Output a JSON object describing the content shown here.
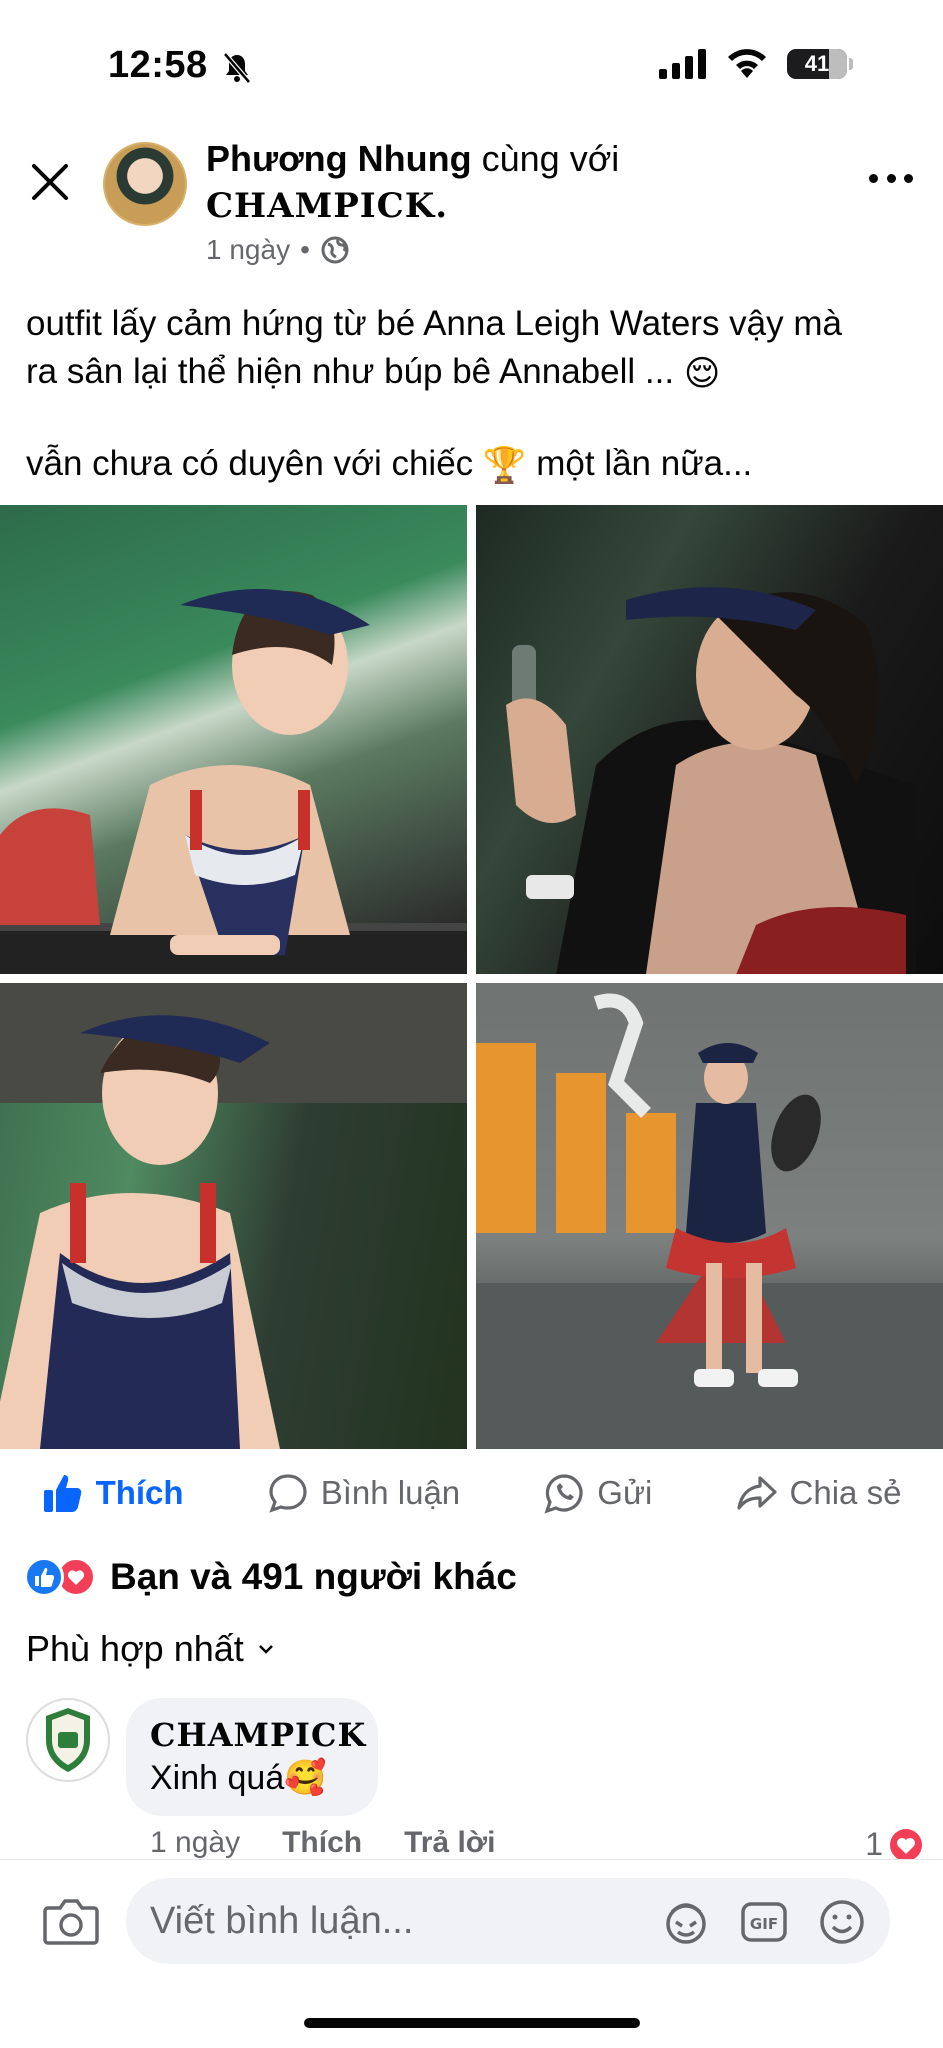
{
  "status_bar": {
    "time": "12:58",
    "battery": "41"
  },
  "post": {
    "author": "Phương Nhung",
    "with_text": "cùng với",
    "tagged": "CHAMPICK.",
    "time": "1 ngày",
    "separator": "•",
    "caption_line1": "outfit lấy cảm hứng từ bé Anna Leigh Waters vậy mà",
    "caption_line2": "ra sân lại thể hiện như búp bê Annabell ...",
    "caption_line3a": "vẫn chưa có duyên với chiếc",
    "caption_line3b": "một lần nữa...",
    "emoji_1": "😌",
    "emoji_2": "🏆"
  },
  "actions": {
    "like": "Thích",
    "comment": "Bình luận",
    "send": "Gửi",
    "share": "Chia sẻ"
  },
  "reactions": {
    "summary": "Bạn và 491 người khác"
  },
  "comments": {
    "sort_label": "Phù hợp nhất",
    "items": [
      {
        "author": "CHAMPICK",
        "text": "Xinh quá",
        "emoji": "🥰",
        "time": "1 ngày",
        "like": "Thích",
        "reply": "Trả lời",
        "reaction_count": "1"
      }
    ]
  },
  "composer": {
    "placeholder": "Viết bình luận..."
  },
  "colors": {
    "facebook_blue": "#0866ff",
    "secondary_text": "#65676b",
    "bubble": "#f0f2f5",
    "love_red": "#f33e58"
  }
}
